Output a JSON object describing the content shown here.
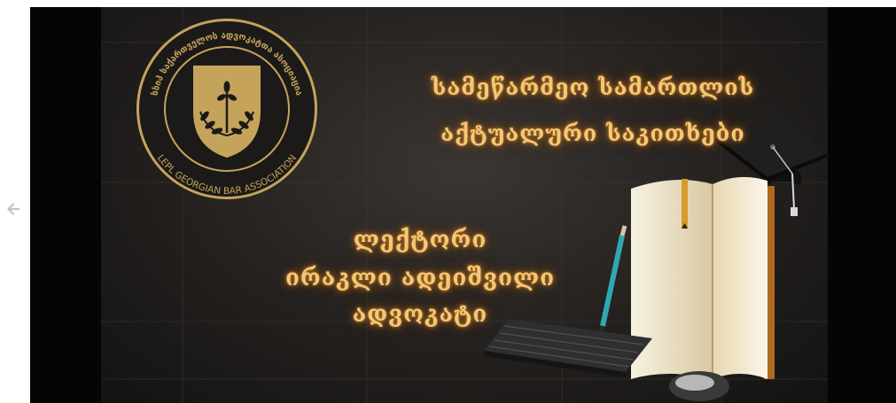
{
  "nav": {
    "back_icon": "arrow-left-icon"
  },
  "slide": {
    "title_line1": "სამეწარმეო სამართლის",
    "title_line2": "აქტუალური საკითხები",
    "lecturer_label": "ლექტორი",
    "lecturer_name": "ირაკლი ადეიშვილი",
    "lecturer_role": "ადვოკატი",
    "logo": {
      "ring_text_top": "სსიპ საქართველოს ადვოკატთა ასოციაცია",
      "ring_text_bottom": "LEPL GEORGIAN BAR ASSOCIATION",
      "emblem_icon": "wheat-branches-icon"
    },
    "illustration_icons": [
      "graduation-cap-icon",
      "open-book-icon",
      "pencil-icon",
      "keyboard-icon",
      "mouse-icon"
    ]
  },
  "colors": {
    "gold": "#f4c876",
    "glow": "#c9852e",
    "logo_gold": "#c5a35b",
    "background": "#23201e"
  }
}
